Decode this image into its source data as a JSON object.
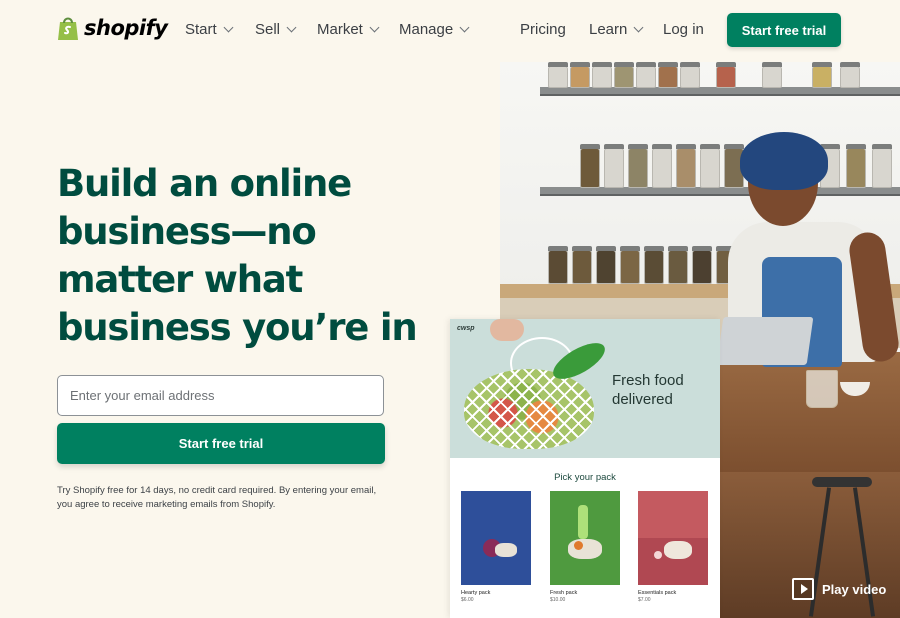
{
  "nav": {
    "brand": "shopify",
    "items": [
      {
        "label": "Start"
      },
      {
        "label": "Sell"
      },
      {
        "label": "Market"
      },
      {
        "label": "Manage"
      }
    ],
    "pricing": "Pricing",
    "learn": "Learn",
    "login": "Log in",
    "cta": "Start free trial"
  },
  "hero": {
    "headline": "Build an online business—no matter what business you’re in",
    "email_placeholder": "Enter your email address",
    "cta": "Start free trial",
    "disclaimer": "Try Shopify free for 14 days, no credit card required. By entering your email, you agree to receive marketing emails from Shopify."
  },
  "store_preview": {
    "logo": "cwsp",
    "title": "Fresh food delivered",
    "subtitle": "Pick your pack",
    "products": [
      {
        "name": "Hearty pack",
        "price": "$6.00"
      },
      {
        "name": "Fresh pack",
        "price": "$10.00"
      },
      {
        "name": "Essentials pack",
        "price": "$7.00"
      }
    ]
  },
  "video": {
    "label": "Play video"
  },
  "colors": {
    "brand_green": "#008060",
    "headline_green": "#004c3f",
    "background": "#fbf7ed"
  },
  "icons": {
    "logo": "shopping-bag-icon",
    "dropdown": "chevron-down-icon",
    "play": "play-icon"
  }
}
